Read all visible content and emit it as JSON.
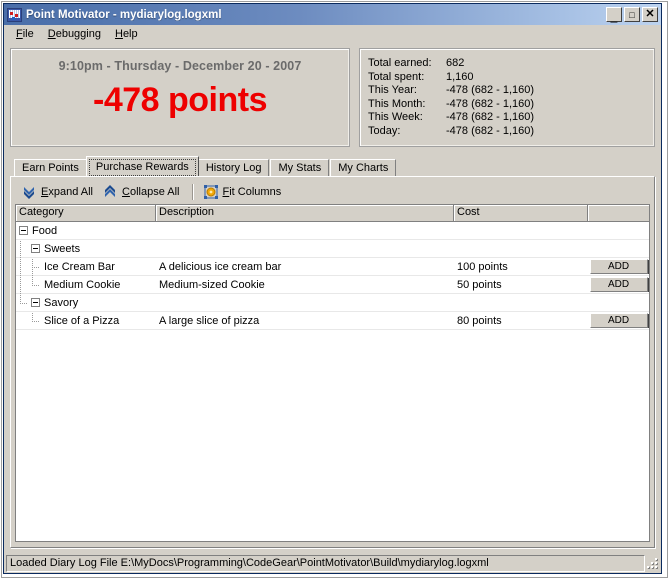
{
  "window": {
    "title": "Point Motivator - mydiarylog.logxml",
    "app_icon": "app-icon",
    "controls": {
      "minimize": "_",
      "maximize": "□",
      "close": "✕"
    }
  },
  "menubar": {
    "items": [
      {
        "label": "File",
        "mnemonic": "F",
        "rest": "ile"
      },
      {
        "label": "Debugging",
        "mnemonic": "D",
        "rest": "ebugging"
      },
      {
        "label": "Help",
        "mnemonic": "H",
        "rest": "elp"
      }
    ]
  },
  "summary_panel": {
    "date_line": "9:10pm - Thursday - December 20 - 2007",
    "points_line": "-478 points",
    "points_color": "#ee0000",
    "date_color": "#6b6b6b"
  },
  "stats_panel": {
    "rows": [
      {
        "label": "Total earned:",
        "value": "682"
      },
      {
        "label": "Total spent:",
        "value": "1,160"
      },
      {
        "label": "This Year:",
        "value": "-478 (682 - 1,160)"
      },
      {
        "label": "This Month:",
        "value": "-478 (682 - 1,160)"
      },
      {
        "label": "This Week:",
        "value": "-478 (682 - 1,160)"
      },
      {
        "label": "Today:",
        "value": "-478 (682 - 1,160)"
      }
    ]
  },
  "tabs": {
    "items": [
      {
        "label": "Earn Points",
        "selected": false
      },
      {
        "label": "Purchase Rewards",
        "selected": true
      },
      {
        "label": "History Log",
        "selected": false
      },
      {
        "label": "My Stats",
        "selected": false
      },
      {
        "label": "My Charts",
        "selected": false
      }
    ]
  },
  "toolbar": {
    "expand_all": {
      "label": "Expand All",
      "mnemonic": "E",
      "rest": "xpand All",
      "icon": "double-chevron-down-icon",
      "icon_color": "#1d4f9e"
    },
    "collapse_all": {
      "label": "Collapse All",
      "mnemonic": "C",
      "rest": "ollapse All",
      "icon": "double-chevron-up-icon",
      "icon_color": "#1d4f9e"
    },
    "fit_columns": {
      "label": "Fit Columns",
      "mnemonic": "F",
      "rest": "it Columns",
      "icon": "fit-columns-icon",
      "icon_color": "#f0a000"
    }
  },
  "grid": {
    "columns": [
      {
        "key": "category",
        "label": "Category"
      },
      {
        "key": "description",
        "label": "Description"
      },
      {
        "key": "cost",
        "label": "Cost"
      },
      {
        "key": "action",
        "label": ""
      }
    ],
    "rows": [
      {
        "type": "group",
        "level": 0,
        "expanded": true,
        "category": "Food",
        "description": "",
        "cost": "",
        "action": ""
      },
      {
        "type": "group",
        "level": 1,
        "expanded": true,
        "category": "Sweets",
        "description": "",
        "cost": "",
        "action": ""
      },
      {
        "type": "leaf",
        "level": 2,
        "last": false,
        "category": "Ice Cream Bar",
        "description": "A delicious ice cream bar",
        "cost": "100 points",
        "action": "ADD"
      },
      {
        "type": "leaf",
        "level": 2,
        "last": true,
        "category": "Medium Cookie",
        "description": "Medium-sized Cookie",
        "cost": "50 points",
        "action": "ADD"
      },
      {
        "type": "group",
        "level": 1,
        "expanded": true,
        "category": "Savory",
        "description": "",
        "cost": "",
        "action": ""
      },
      {
        "type": "leaf",
        "level": 2,
        "last": true,
        "category": "Slice of a Pizza",
        "description": "A large slice of pizza",
        "cost": "80 points",
        "action": "ADD"
      }
    ]
  },
  "statusbar": {
    "message": "Loaded Diary Log File E:\\MyDocs\\Programming\\CodeGear\\PointMotivator\\Build\\mydiarylog.logxml"
  }
}
